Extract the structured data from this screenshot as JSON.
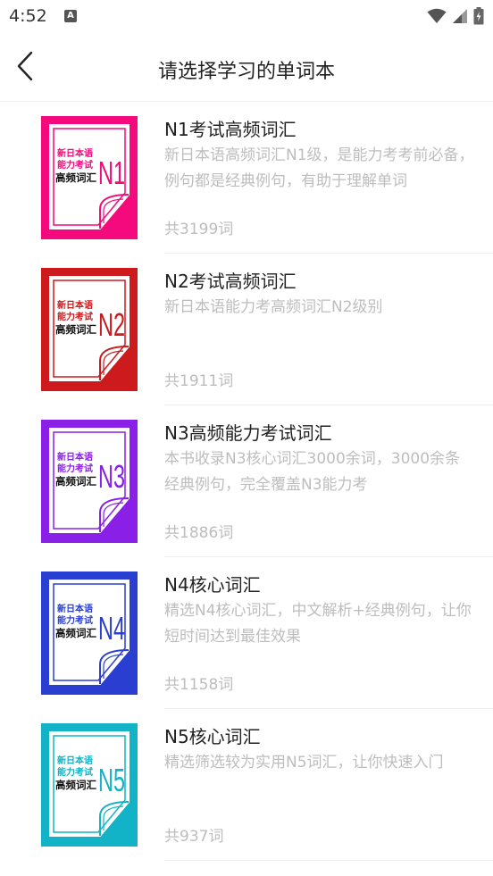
{
  "status_bar": {
    "time": "4:52",
    "notification_badge": "A"
  },
  "header": {
    "title": "请选择学习的单词本"
  },
  "books": [
    {
      "title": "N1考试高频词汇",
      "description": "新日本语高频词汇N1级，是能力考考前必备，例句都是经典例句，有助于理解单词",
      "count": "共3199词",
      "cover": {
        "color": "#f40a7c",
        "line1": "新日本语",
        "line2": "能力考试",
        "line3": "高频词汇",
        "level": "N1"
      }
    },
    {
      "title": "N2考试高频词汇",
      "description": "新日本语能力考高频词汇N2级别",
      "count": "共1911词",
      "cover": {
        "color": "#cc1a1d",
        "line1": "新日本语",
        "line2": "能力考试",
        "line3": "高频词汇",
        "level": "N2"
      }
    },
    {
      "title": "N3高频能力考试词汇",
      "description": "本书收录N3核心词汇3000余词，3000余条经典例句，完全覆盖N3能力考",
      "count": "共1886词",
      "cover": {
        "color": "#8a1fe8",
        "line1": "新日本语",
        "line2": "能力考试",
        "line3": "高频词汇",
        "level": "N3"
      }
    },
    {
      "title": "N4核心词汇",
      "description": "精选N4核心词汇，中文解析+经典例句，让你短时间达到最佳效果",
      "count": "共1158词",
      "cover": {
        "color": "#2a3fd1",
        "line1": "新日本语",
        "line2": "能力考试",
        "line3": "高频词汇",
        "level": "N4"
      }
    },
    {
      "title": "N5核心词汇",
      "description": "精选筛选较为实用N5词汇，让你快速入门",
      "count": "共937词",
      "cover": {
        "color": "#12b3c6",
        "line1": "新日本语",
        "line2": "能力考试",
        "line3": "高频词汇",
        "level": "N5"
      }
    }
  ]
}
